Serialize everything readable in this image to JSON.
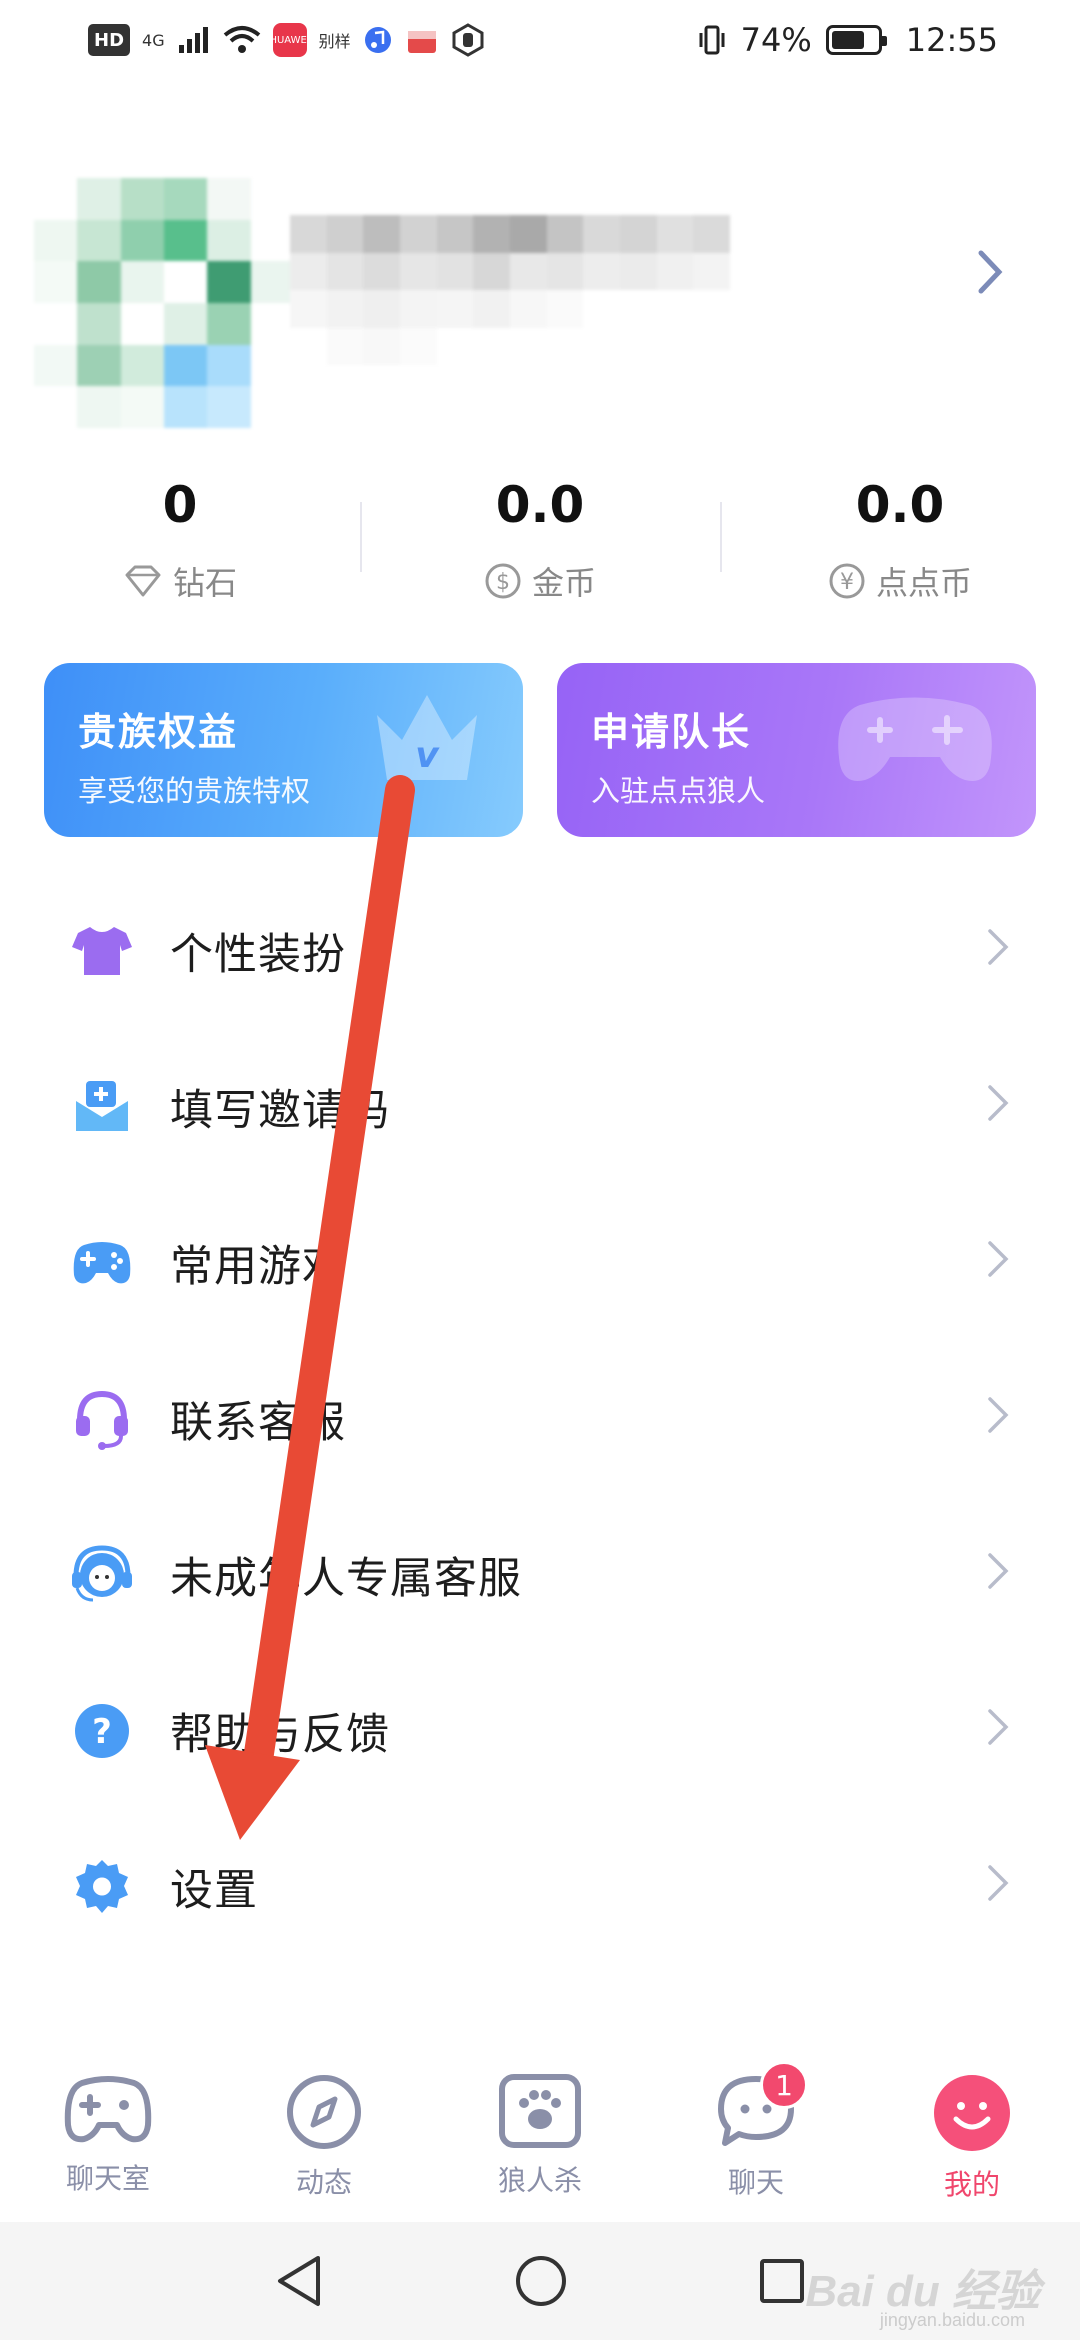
{
  "status_bar": {
    "left_chips": [
      "HD",
      "4G"
    ],
    "app_label": "别样",
    "huawei_label": "HUAWEI",
    "battery_percent": "74%",
    "time": "12:55",
    "battery_level": 0.74
  },
  "profile": {
    "arrow_icon": "chevron-right-icon"
  },
  "stats": [
    {
      "value": "0",
      "label": "钻石",
      "icon": "diamond-icon"
    },
    {
      "value": "0.0",
      "label": "金币",
      "icon": "dollar-coin-icon"
    },
    {
      "value": "0.0",
      "label": "点点币",
      "icon": "yen-coin-icon"
    }
  ],
  "cards": {
    "noble": {
      "title": "贵族权益",
      "subtitle": "享受您的贵族特权",
      "color": "#3e8ff8"
    },
    "captain": {
      "title": "申请队长",
      "subtitle": "入驻点点狼人",
      "color": "#9663f6"
    }
  },
  "menu": [
    {
      "label": "个性装扮",
      "icon": "tshirt-icon"
    },
    {
      "label": "填写邀请码",
      "icon": "invite-mail-icon"
    },
    {
      "label": "常用游戏",
      "icon": "gamepad-icon"
    },
    {
      "label": "联系客服",
      "icon": "headset-icon"
    },
    {
      "label": "未成年人专属客服",
      "icon": "support-agent-icon"
    },
    {
      "label": "帮助与反馈",
      "icon": "help-icon"
    },
    {
      "label": "设置",
      "icon": "gear-icon"
    }
  ],
  "tabs": [
    {
      "label": "聊天室",
      "icon": "gamepad-icon"
    },
    {
      "label": "动态",
      "icon": "compass-icon"
    },
    {
      "label": "狼人杀",
      "icon": "paw-icon"
    },
    {
      "label": "聊天",
      "icon": "chat-bubble-icon",
      "badge": "1"
    },
    {
      "label": "我的",
      "icon": "smiley-icon",
      "active": true
    }
  ],
  "watermark": {
    "text": "Bai du 经验",
    "sub": "jingyan.baidu.com"
  },
  "colors": {
    "accent_pink": "#f0466c",
    "tab_inactive": "#8a8fa8",
    "annotation_arrow": "#e84a35"
  }
}
